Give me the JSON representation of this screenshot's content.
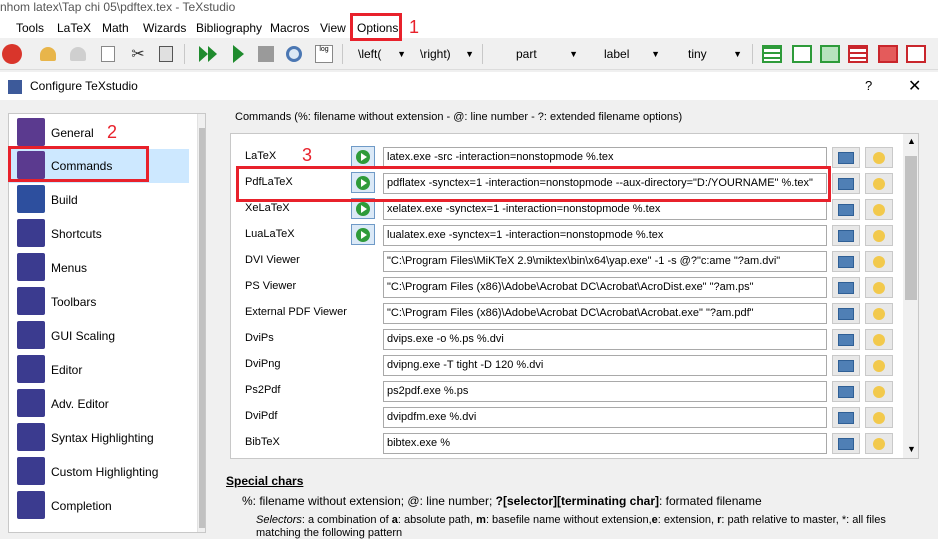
{
  "window": {
    "title": "nhom latex\\Tap chi 05\\pdftex.tex - TeXstudio"
  },
  "menubar": [
    "Tools",
    "LaTeX",
    "Math",
    "Wizards",
    "Bibliography",
    "Macros",
    "View",
    "Options"
  ],
  "toolbar": {
    "combos": [
      "\\left(",
      "\\right)",
      "part",
      "label",
      "tiny"
    ]
  },
  "dialog": {
    "title": "Configure TeXstudio",
    "help": "?",
    "close": "✕"
  },
  "sidebar": {
    "items": [
      {
        "label": "General",
        "color": "#5b3a8f"
      },
      {
        "label": "Commands",
        "color": "#5b3a8f"
      },
      {
        "label": "Build",
        "color": "#2d4f9e"
      },
      {
        "label": "Shortcuts",
        "color": "#3b3b8f"
      },
      {
        "label": "Menus",
        "color": "#3b3b8f"
      },
      {
        "label": "Toolbars",
        "color": "#3b3b8f"
      },
      {
        "label": "GUI Scaling",
        "color": "#3b3b8f"
      },
      {
        "label": "Editor",
        "color": "#3b3b8f"
      },
      {
        "label": "Adv. Editor",
        "color": "#3b3b8f"
      },
      {
        "label": "Syntax Highlighting",
        "color": "#3b3b8f"
      },
      {
        "label": "Custom Highlighting",
        "color": "#3b3b8f"
      },
      {
        "label": "Completion",
        "color": "#3b3b8f"
      }
    ],
    "selected": "Commands"
  },
  "commands": {
    "header": "Commands (%: filename without extension - @: line number - ?: extended filename options)",
    "rows": [
      {
        "name": "LaTeX",
        "value": "latex.exe -src -interaction=nonstopmode %.tex",
        "run": true
      },
      {
        "name": "PdfLaTeX",
        "value": "pdflatex -synctex=1 -interaction=nonstopmode --aux-directory=\"D:/YOURNAME\" %.tex\"",
        "run": true
      },
      {
        "name": "XeLaTeX",
        "value": "xelatex.exe -synctex=1 -interaction=nonstopmode %.tex",
        "run": true
      },
      {
        "name": "LuaLaTeX",
        "value": "lualatex.exe -synctex=1 -interaction=nonstopmode %.tex",
        "run": true
      },
      {
        "name": "DVI Viewer",
        "value": "\"C:\\Program Files\\MiKTeX 2.9\\miktex\\bin\\x64\\yap.exe\" -1 -s @?\"c:ame \"?am.dvi\"",
        "run": false
      },
      {
        "name": "PS Viewer",
        "value": "\"C:\\Program Files (x86)\\Adobe\\Acrobat DC\\Acrobat\\AcroDist.exe\" \"?am.ps\"",
        "run": false
      },
      {
        "name": "External PDF Viewer",
        "value": "\"C:\\Program Files (x86)\\Adobe\\Acrobat DC\\Acrobat\\Acrobat.exe\" \"?am.pdf\"",
        "run": false
      },
      {
        "name": "DviPs",
        "value": "dvips.exe -o %.ps %.dvi",
        "run": false
      },
      {
        "name": "DviPng",
        "value": "dvipng.exe -T tight -D 120 %.dvi",
        "run": false
      },
      {
        "name": "Ps2Pdf",
        "value": "ps2pdf.exe %.ps",
        "run": false
      },
      {
        "name": "DviPdf",
        "value": "dvipdfm.exe %.dvi",
        "run": false
      },
      {
        "name": "BibTeX",
        "value": "bibtex.exe %",
        "run": false
      }
    ]
  },
  "special": {
    "title": "Special chars",
    "line1_a": "%: filename without extension; @: line number; ",
    "line1_b": "?[selector][terminating char]",
    "line1_c": ": formated filename",
    "line2_a": "Selectors",
    "line2_b": ": a combination of ",
    "line2_c": "a",
    "line2_d": ": absolute path, ",
    "line2_e": "m",
    "line2_f": ": basefile name without extension,",
    "line2_g": "e",
    "line2_h": ": extension, ",
    "line2_i": "r",
    "line2_j": ": path relative to master, *: all files",
    "line3": "matching the following pattern"
  },
  "annotations": {
    "one": "1",
    "two": "2",
    "three": "3",
    "color": "#e8212b"
  }
}
